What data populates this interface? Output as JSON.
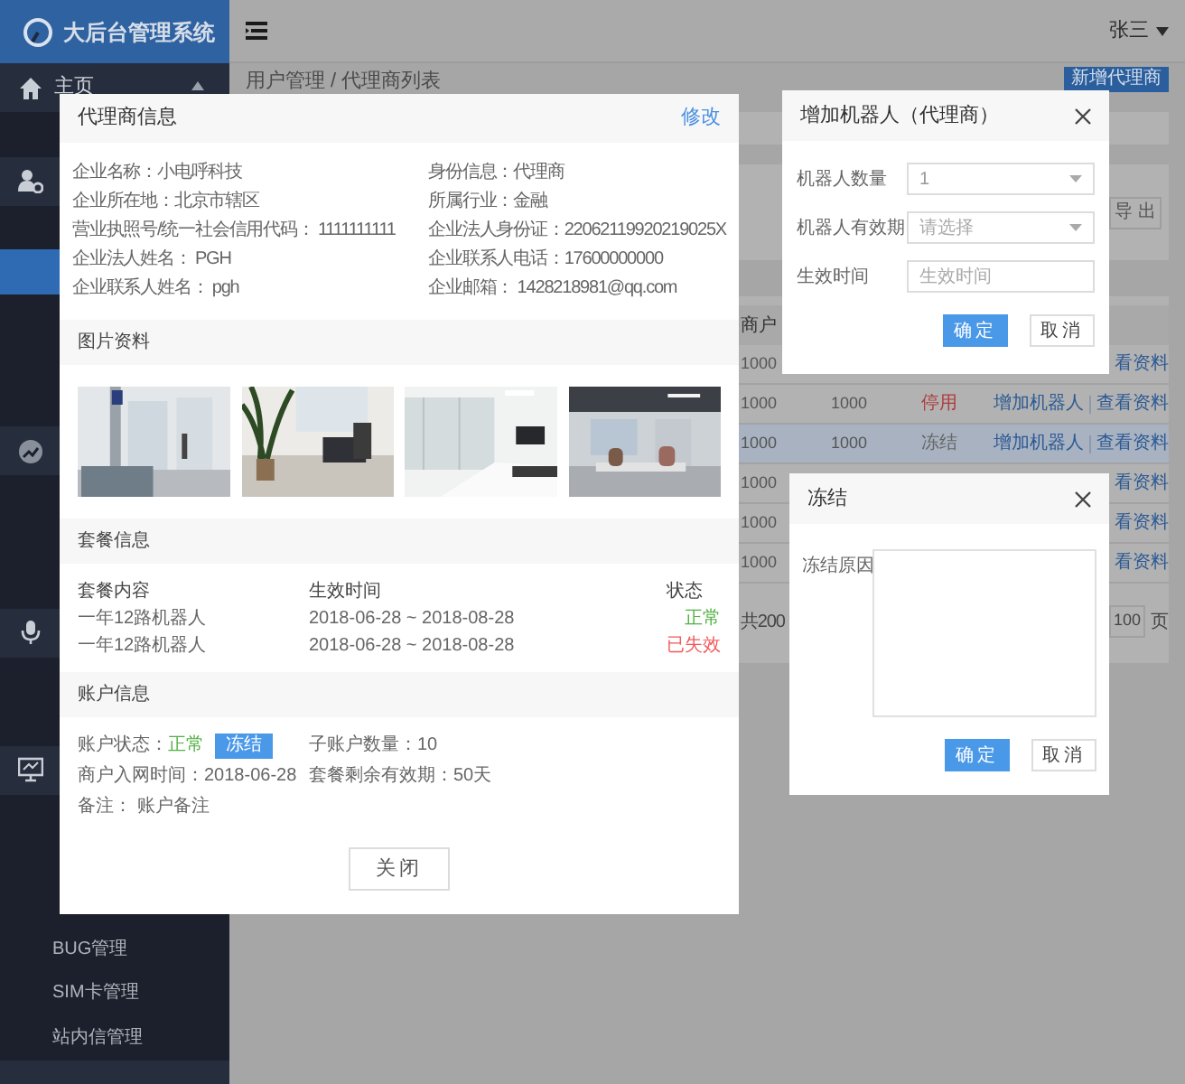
{
  "sidebar": {
    "logo": "大后台管理系统",
    "menu": [
      {
        "kind": "group",
        "label": "主页",
        "expanded": true
      },
      {
        "kind": "item",
        "selected": false
      },
      {
        "kind": "group"
      },
      {
        "kind": "item",
        "selected": false
      },
      {
        "kind": "item",
        "selected": true
      },
      {
        "kind": "item",
        "selected": false
      },
      {
        "kind": "item",
        "selected": false
      },
      {
        "kind": "item",
        "selected": false
      },
      {
        "kind": "group"
      },
      {
        "kind": "item",
        "selected": false
      },
      {
        "kind": "item",
        "selected": false
      },
      {
        "kind": "item",
        "selected": false
      },
      {
        "kind": "group"
      },
      {
        "kind": "item",
        "selected": false
      },
      {
        "kind": "item",
        "selected": false
      },
      {
        "kind": "group"
      },
      {
        "kind": "item",
        "selected": false
      },
      {
        "kind": "item",
        "selected": false
      },
      {
        "kind": "item",
        "selected": false
      },
      {
        "kind": "item",
        "label": "BUG管理",
        "selected": false
      },
      {
        "kind": "item",
        "label": "SIM卡管理",
        "selected": false
      },
      {
        "kind": "item",
        "label": "站内信管理",
        "selected": false
      }
    ]
  },
  "header": {
    "user": "张三"
  },
  "breadcrumb": "用户管理 / 代理商列表",
  "add_button": "新增代理商",
  "export_button": "导 出",
  "table": {
    "header": "商户",
    "rows": [
      {
        "col1": "1000",
        "actions": [
          "看资料"
        ],
        "selected": false
      },
      {
        "col1": "1000",
        "col2": "1000",
        "status": "停用",
        "color": "#b03a3a",
        "actions": [
          "增加机器人",
          "查看资料"
        ],
        "selected": false
      },
      {
        "col1": "1000",
        "col2": "1000",
        "status": "冻结",
        "color": "#666666",
        "actions": [
          "增加机器人",
          "查看资料"
        ],
        "selected": true
      },
      {
        "col1": "1000",
        "actions": [
          "看资料"
        ],
        "selected": false
      },
      {
        "col1": "1000",
        "actions": [
          "看资料"
        ],
        "selected": false
      },
      {
        "col1": "1000",
        "actions": [
          "看资料"
        ],
        "selected": false
      }
    ],
    "total": "共200",
    "page_size": "100",
    "page_suffix": "页"
  },
  "agent_modal": {
    "title": "代理商信息",
    "edit_link": "修改",
    "info": [
      "企业名称：小电呼科技",
      "身份信息：代理商",
      "企业所在地：北京市辖区",
      "所属行业：金融",
      "营业执照号/统一社会信用代码： 1111111111",
      "企业法人身份证：22062119920219025X",
      "企业法人姓名： PGH",
      "企业联系人电话：17600000000",
      "企业联系人姓名： pgh",
      "企业邮箱： 1428218981@qq.com"
    ],
    "photos_title": "图片资料",
    "photos": [
      {
        "kind": "picture"
      },
      {
        "kind": "picture"
      },
      {
        "kind": "picture"
      },
      {
        "kind": "picture"
      }
    ],
    "package_title": "套餐信息",
    "package_columns": [
      "套餐内容",
      "生效时间",
      "状态"
    ],
    "package_rows": [
      {
        "content": "一年12路机器人",
        "period": "2018-06-28 ~ 2018-08-28",
        "status": "正常",
        "color": "#52b043"
      },
      {
        "content": "一年12路机器人",
        "period": "2018-06-28 ~ 2018-08-28",
        "status": "已失效",
        "color": "#f25a5a"
      }
    ],
    "account_title": "账户信息",
    "account_status_label": "账户状态：",
    "account_status": "正常",
    "freeze_button": "冻结",
    "sub_accounts": "子账户数量：10",
    "join_date": "商户入网时间：2018-06-28",
    "remaining": "套餐剩余有效期：50天",
    "note": "备注： 账户备注",
    "close_button": "关闭"
  },
  "robot_modal": {
    "title": "增加机器人（代理商）",
    "fields": [
      {
        "label": "机器人数量",
        "kind": "select",
        "value": "1"
      },
      {
        "label": "机器人有效期",
        "kind": "select",
        "placeholder": "请选择"
      },
      {
        "label": "生效时间",
        "kind": "input",
        "placeholder": "生效时间"
      }
    ],
    "confirm": "确定",
    "cancel": "取消"
  },
  "freeze_modal": {
    "title": "冻结",
    "label": "冻结原因",
    "confirm": "确定",
    "cancel": "取消"
  }
}
